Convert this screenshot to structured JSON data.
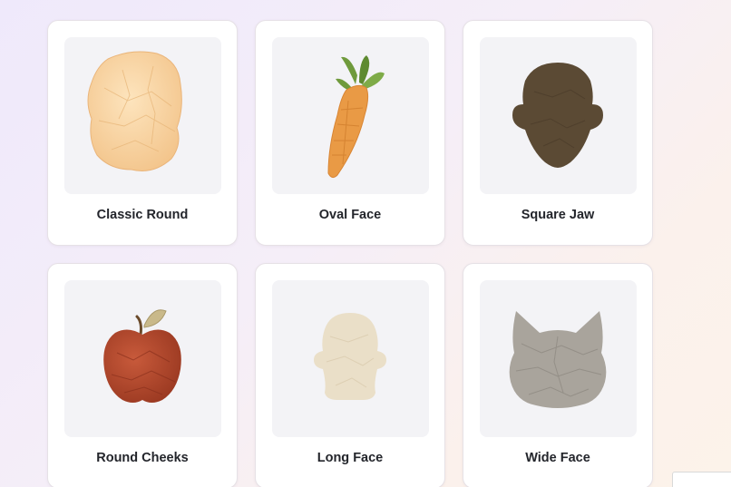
{
  "face_shapes": [
    {
      "label": "Classic Round",
      "icon": "crumpled-paper-round-icon"
    },
    {
      "label": "Oval Face",
      "icon": "carrot-icon"
    },
    {
      "label": "Square Jaw",
      "icon": "dark-head-silhouette-icon"
    },
    {
      "label": "Round Cheeks",
      "icon": "apple-icon"
    },
    {
      "label": "Long Face",
      "icon": "light-head-silhouette-icon"
    },
    {
      "label": "Wide Face",
      "icon": "cat-head-icon"
    }
  ],
  "colors": {
    "round_paper": "#f6cd98",
    "carrot": "#e99a45",
    "carrot_leaves": "#6f9a3c",
    "dark_head": "#5b4a34",
    "apple": "#b7472c",
    "light_head": "#eadfc8",
    "cat_head": "#a9a49c"
  }
}
